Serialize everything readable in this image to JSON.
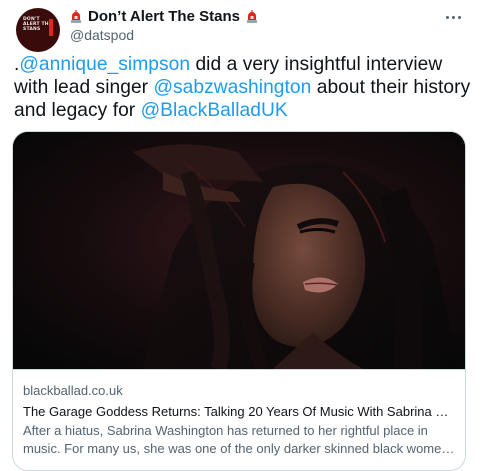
{
  "tweet": {
    "display_name": "Don’t Alert The Stans",
    "handle": "@datspod",
    "avatar_text": "DON'T ALERT THE STANS",
    "text": {
      "prefix": ".",
      "mention_1": "@annique_simpson",
      "part_1": " did a very insightful interview with lead singer ",
      "mention_2": "@sabzwashington",
      "part_2": " about their history and legacy for ",
      "mention_3": "@BlackBalladUK"
    }
  },
  "card": {
    "domain": "blackballad.co.uk",
    "title": "The Garage Goddess Returns: Talking 20 Years Of Music With Sabrina Washington",
    "description": "After a hiatus, Sabrina Washington has returned to her rightful place in music. For many us, she was one of the only darker skinned black women we saw at the forefront of the UK garage scene."
  },
  "icons": {
    "siren": "police-light-icon",
    "more": "more-options-icon"
  },
  "colors": {
    "link": "#1d9bf0",
    "secondary_text": "#536471",
    "border": "#cfd9de",
    "siren_red": "#e0271c"
  }
}
